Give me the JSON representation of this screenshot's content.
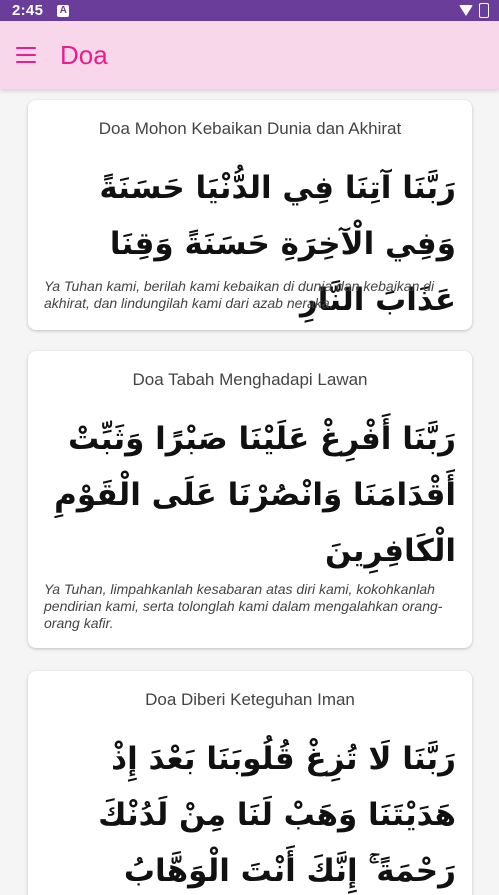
{
  "status_bar": {
    "time": "2:45",
    "notification_icon": "A",
    "battery_icon": "battery-icon",
    "wifi_icon": "wifi-icon"
  },
  "app_bar": {
    "title": "Doa",
    "menu_icon": "hamburger-menu-icon",
    "accent": "#e91e8c",
    "background": "#f8d7ea"
  },
  "doas": [
    {
      "title": "Doa Mohon Kebaikan Dunia dan Akhirat",
      "arabic": "رَبَّنَا آتِنَا فِي الدُّنْيَا حَسَنَةً وَفِي الْآخِرَةِ حَسَنَةً وَقِنَا عَذَابَ النَّارِ",
      "translation": "Ya Tuhan kami, berilah kami kebaikan di dunia dan kebaikan di akhirat, dan lindungilah kami dari azab neraka."
    },
    {
      "title": "Doa Tabah Menghadapi Lawan",
      "arabic": "رَبَّنَا أَفْرِغْ عَلَيْنَا صَبْرًا وَثَبِّتْ أَقْدَامَنَا وَانْصُرْنَا عَلَى الْقَوْمِ الْكَافِرِينَ",
      "translation": "Ya Tuhan, limpahkanlah kesabaran atas diri kami, kokohkanlah pendirian kami, serta tolonglah kami dalam mengalahkan orang-orang kafir."
    },
    {
      "title": "Doa Diberi Keteguhan Iman",
      "arabic": "رَبَّنَا لَا تُزِغْ قُلُوبَنَا بَعْدَ إِذْ هَدَيْتَنَا وَهَبْ لَنَا مِنْ لَدُنْكَ رَحْمَةً ۚ إِنَّكَ أَنْتَ الْوَهَّابُ",
      "translation": ""
    }
  ]
}
